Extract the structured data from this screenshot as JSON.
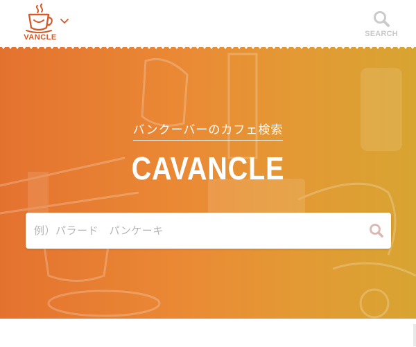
{
  "header": {
    "logo_text": "VANCLE",
    "logo_icon": "coffee-cup-icon",
    "menu_icon": "chevron-down-icon",
    "search_label": "SEARCH",
    "search_icon": "search-icon"
  },
  "hero": {
    "tagline": "バンクーバーのカフェ検索",
    "title": "CAVANCLE",
    "search_placeholder": "例）パラード　パンケーキ",
    "search_value": ""
  },
  "colors": {
    "brand": "#d35a2a",
    "hero_gradient_start": "#e4722f",
    "hero_gradient_end": "#d8a431",
    "muted_icon": "#c9c9c9",
    "search_submit_icon": "#d9b8b2"
  }
}
